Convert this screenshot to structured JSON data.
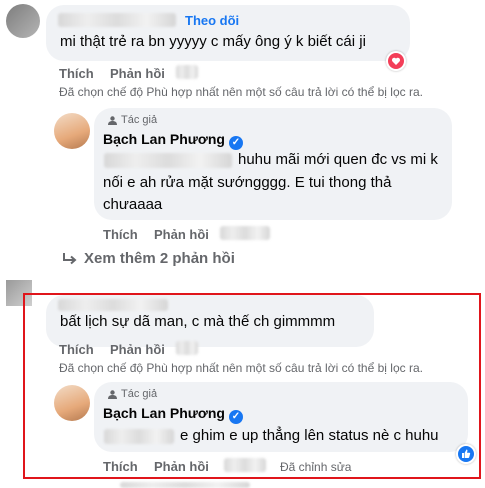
{
  "comment1": {
    "follow_label": "Theo dõi",
    "text": "mi thật trẻ ra bn yyyyy c mấy ông ý k biết cái ji",
    "like_label": "Thích",
    "reply_label": "Phản hồi"
  },
  "filter_note": "Đã chọn chế độ Phù hợp nhất nên một số câu trả lời có thể bị lọc ra.",
  "reply1": {
    "author_tag": "Tác giả",
    "author_name": "Bạch Lan Phương",
    "text_line1": "huhu mãi mới quen đc vs mi k",
    "text_line2": "nối e ah rửa mặt sướngggg. E tui thong thả",
    "text_line3": "chưaaaa",
    "like_label": "Thích",
    "reply_label": "Phản hồi"
  },
  "see_more": "Xem thêm 2 phản hồi",
  "comment2": {
    "text": "bất lịch sự dã man, c mà thế ch gimmmm",
    "like_label": "Thích",
    "reply_label": "Phản hồi"
  },
  "filter_note2": "Đã chọn chế độ Phù hợp nhất nên một số câu trả lời có thể bị lọc ra.",
  "reply2": {
    "author_tag": "Tác giả",
    "author_name": "Bạch Lan Phương",
    "text": "e ghim e up thẳng lên status nè c huhu",
    "like_label": "Thích",
    "reply_label": "Phản hồi",
    "edited_label": "Đã chỉnh sửa"
  },
  "colors": {
    "accent": "#1877f2",
    "highlight_box": "#e0151b",
    "bubble": "#f0f2f5",
    "reaction_love": "#f33e58"
  }
}
